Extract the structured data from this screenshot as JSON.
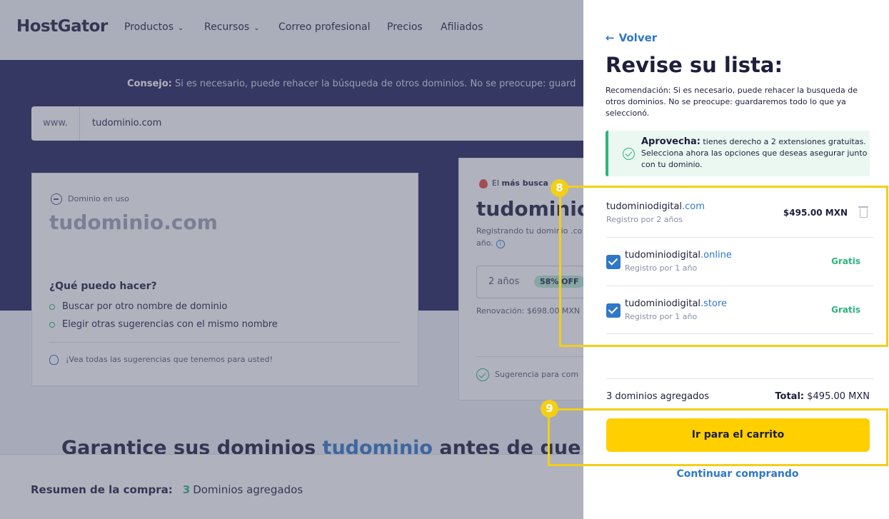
{
  "nav": {
    "logo": "HostGator",
    "items": [
      "Productos",
      "Recursos",
      "Correo profesional",
      "Precios",
      "Afiliados"
    ]
  },
  "hero": {
    "tip_bold": "Consejo:",
    "tip_text": " Si es necesario, puede rehacer la búsqueda de otros dominios. No se preocupe: guard",
    "search_prefix": "www.",
    "search_value": "tudominio.com"
  },
  "left_card": {
    "status": "Dominio en uso",
    "domain": "tudominio.com",
    "question": "¿Qué puedo hacer?",
    "options": [
      "Buscar por otro nombre de dominio",
      "Elegir otras sugerencias con el mismo nombre"
    ],
    "see_all": "¡Vea todas las sugerencias que tenemos para usted!"
  },
  "right_card": {
    "popular_prefix": "El ",
    "popular_bold": "más busca",
    "domain": "tudominio",
    "registering_line1": "Registrando tu dominio .co",
    "registering_line2": "año.",
    "term": "2 años",
    "discount": "58% OFF",
    "renewal": "Renovación: $698.00 MXN",
    "suggestion": "Sugerencia para com"
  },
  "guarantee": {
    "pre": "Garantice sus dominios ",
    "highlight": "tudominio",
    "post": " antes de que al"
  },
  "summary": {
    "label": "Resumen de la compra:",
    "count": "3",
    "text": "Dominios agregados"
  },
  "drawer": {
    "back": "Volver",
    "title": "Revise su lista:",
    "recommendation": "Recomendación: Si es necesario, puede rehacer la busqueda de otros dominios. No se preocupe: guardaremos todo lo que ya seleccionó.",
    "promo_bold": "Aprovecha:",
    "promo_text": " tienes derecho a 2 extensiones gratuitas. Selecciona ahora las opciones que deseas asegurar junto con tu dominio.",
    "main_item": {
      "name": "tudominiodigital",
      "tld": ".com",
      "registration": "Registro por 2 años",
      "price": "$495.00 MXN"
    },
    "extras": [
      {
        "name": "tudominiodigital",
        "tld": ".online",
        "registration": "Registro por 1 año",
        "price": "Gratis",
        "checked": true
      },
      {
        "name": "tudominiodigital",
        "tld": ".store",
        "registration": "Registro por 1 año",
        "price": "Gratis",
        "checked": true
      }
    ],
    "count_text": "3 dominios agregados",
    "total_label": "Total:",
    "total_value": "$495.00 MXN",
    "cart_button": "Ir para el carrito",
    "continue_link": "Continuar comprando"
  },
  "annotations": {
    "badge_1": "8",
    "badge_2": "9"
  },
  "colors": {
    "accent_blue": "#2f77c9",
    "cta_yellow": "#ffcf00",
    "success_green": "#2db57a",
    "annotation_yellow": "#f3cf16"
  }
}
